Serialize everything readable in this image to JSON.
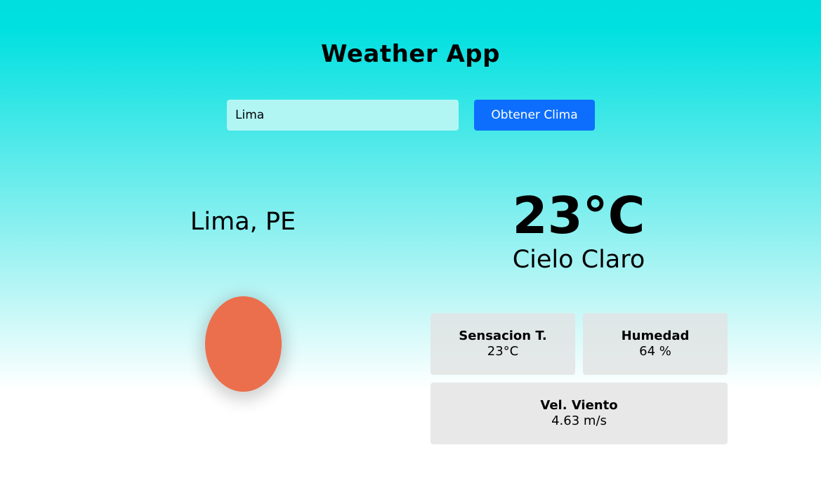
{
  "header": {
    "title": "Weather App"
  },
  "search": {
    "value": "Lima",
    "button_label": "Obtener Clima"
  },
  "location": {
    "city": "Lima, PE",
    "icon": "sun-icon"
  },
  "current": {
    "temperature": "23°C",
    "condition": "Cielo Claro"
  },
  "details": {
    "feels_like": {
      "label": "Sensacion T.",
      "value": "23°C"
    },
    "humidity": {
      "label": "Humedad",
      "value": "64 %"
    },
    "wind": {
      "label": "Vel. Viento",
      "value": "4.63 m/s"
    }
  },
  "colors": {
    "background_top": "#00e0e0",
    "background_bottom": "#ffffff",
    "button": "#0d6efd",
    "sun": "#eb6f4c",
    "input_bg": "#b2f6f4"
  }
}
